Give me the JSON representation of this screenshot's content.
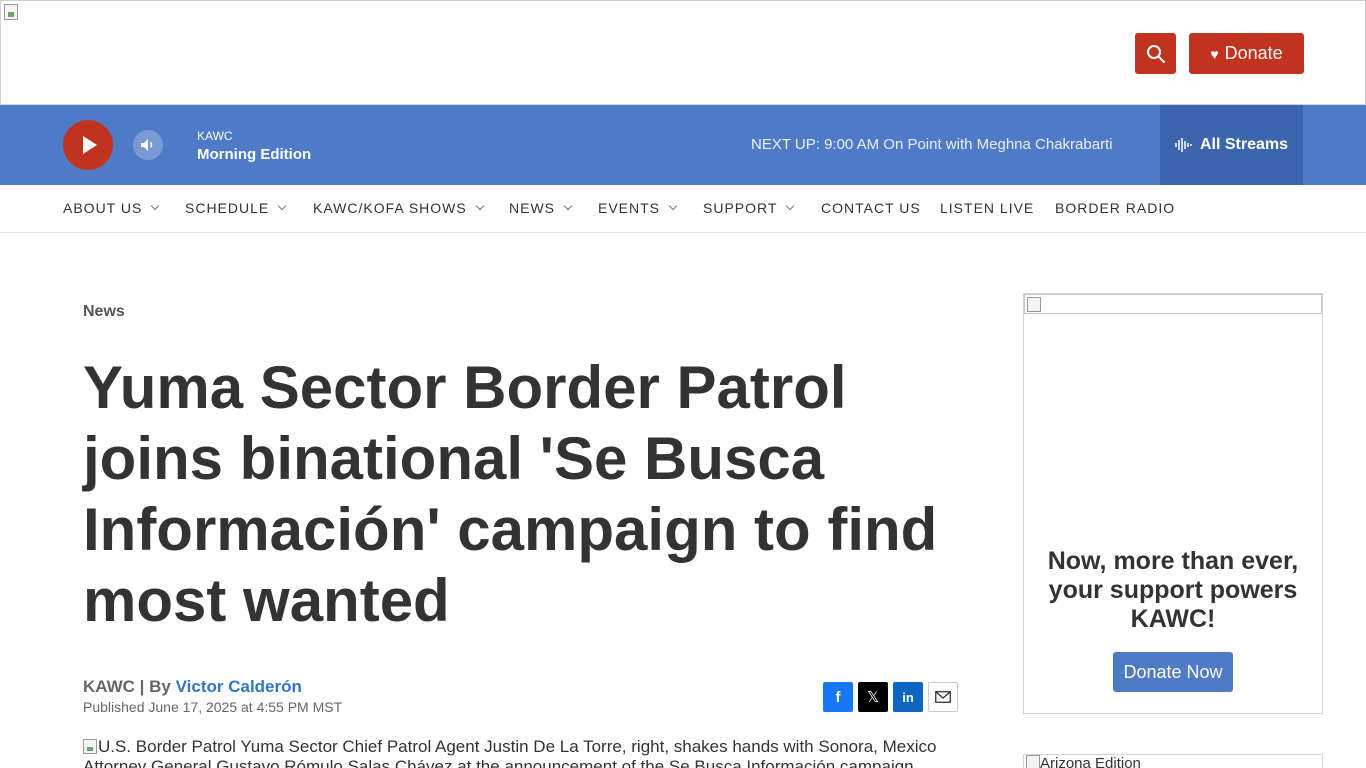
{
  "header": {
    "donate_label": "Donate"
  },
  "player": {
    "station": "KAWC",
    "program": "Morning Edition",
    "next_up": "NEXT UP: 9:00 AM On Point with Meghna Chakrabarti",
    "streams_label": "All Streams"
  },
  "nav": {
    "items": [
      {
        "label": "ABOUT US",
        "dropdown": true
      },
      {
        "label": "SCHEDULE",
        "dropdown": true
      },
      {
        "label": "KAWC/KOFA SHOWS",
        "dropdown": true
      },
      {
        "label": "NEWS",
        "dropdown": true
      },
      {
        "label": "EVENTS",
        "dropdown": true
      },
      {
        "label": "SUPPORT",
        "dropdown": true
      },
      {
        "label": "CONTACT US",
        "dropdown": false
      },
      {
        "label": "LISTEN LIVE",
        "dropdown": false
      },
      {
        "label": "BORDER RADIO",
        "dropdown": false
      }
    ]
  },
  "article": {
    "category": "News",
    "headline": "Yuma Sector Border Patrol joins binational 'Se Busca Información' campaign to find most wanted",
    "source": "KAWC",
    "by": " | By ",
    "author": "Victor Calderón",
    "published": "Published June 17, 2025 at 4:55 PM MST",
    "image_alt": "U.S. Border Patrol Yuma Sector Chief Patrol Agent Justin De La Torre, right, shakes hands with Sonora, Mexico Attorney General Gustavo Rómulo Salas Chávez at the announcement of the Se Busca Información campaign"
  },
  "share": {
    "facebook": "f",
    "x": "𝕏",
    "linkedin": "in"
  },
  "sidebar": {
    "ad_text": "Now, more than ever, your support powers KAWC!",
    "ad_button": "Donate Now",
    "arizona_alt": "Arizona Edition"
  },
  "colors": {
    "brand_red": "#c0341f",
    "player_blue": "#4f7ac7",
    "streams_blue": "#3c65ae",
    "link_blue": "#2f77c5"
  },
  "icons": [
    "search-icon",
    "heart-icon",
    "play-icon",
    "volume-icon",
    "audio-wave-icon",
    "chevron-down-icon",
    "facebook-icon",
    "x-icon",
    "linkedin-icon",
    "email-icon"
  ]
}
